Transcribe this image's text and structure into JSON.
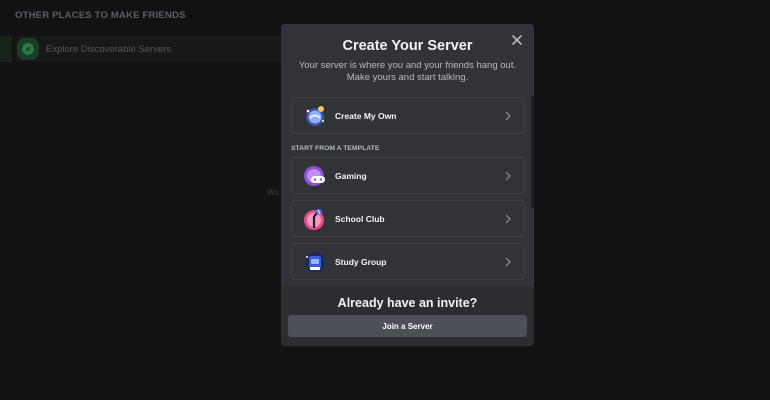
{
  "background": {
    "section_title": "OTHER PLACES TO MAKE FRIENDS",
    "explore_label": "Explore Discoverable Servers",
    "partial_text": "Wu"
  },
  "modal": {
    "title": "Create Your Server",
    "subtitle": "Your server is where you and your friends hang out. Make yours and start talking.",
    "create_own_label": "Create My Own",
    "template_header": "START FROM A TEMPLATE",
    "templates": [
      {
        "label": "Gaming",
        "icon": "gaming-icon"
      },
      {
        "label": "School Club",
        "icon": "school-club-icon"
      },
      {
        "label": "Study Group",
        "icon": "study-group-icon"
      }
    ],
    "footer_title": "Already have an invite?",
    "join_label": "Join a Server"
  },
  "colors": {
    "page_bg": "#111214",
    "modal_bg": "#313338",
    "footer_bg": "#2b2d31",
    "button_bg": "#4e5058",
    "text_primary": "#f2f3f5",
    "text_secondary": "#b5bac1"
  }
}
